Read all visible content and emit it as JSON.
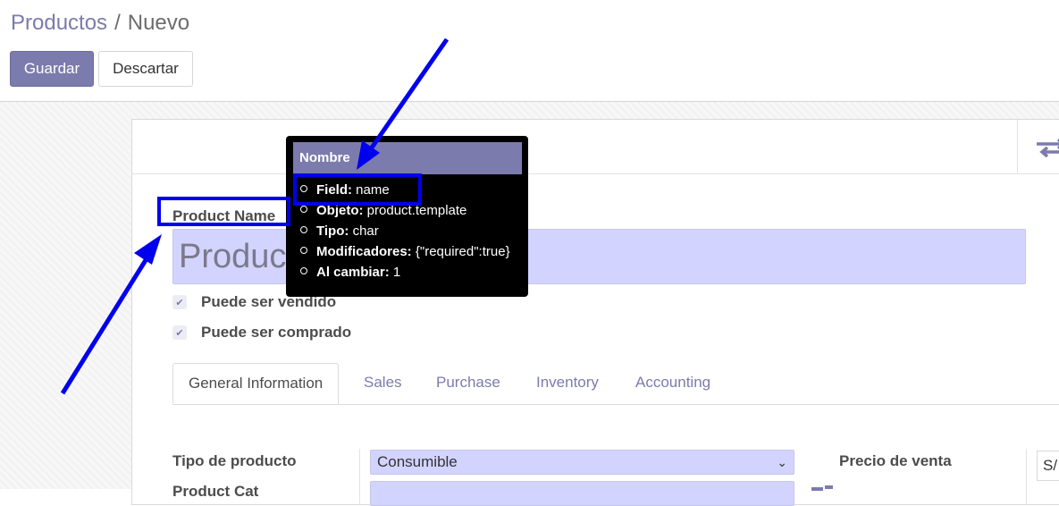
{
  "breadcrumb": {
    "parent": "Productos",
    "separator": "/",
    "current": "Nuevo"
  },
  "actions": {
    "save_label": "Guardar",
    "discard_label": "Descartar"
  },
  "form": {
    "name_label": "Product Name",
    "name_placeholder": "Product",
    "checkboxes": [
      {
        "label": "Puede ser vendido",
        "checked": true
      },
      {
        "label": "Puede ser comprado",
        "checked": true
      }
    ],
    "tabs": [
      "General Information",
      "Sales",
      "Purchase",
      "Inventory",
      "Accounting"
    ],
    "active_tab": "General Information",
    "fields": {
      "product_type_label": "Tipo de producto",
      "product_type_value": "Consumible",
      "category_label": "Product Cat",
      "sale_price_label": "Precio de venta",
      "currency_value": "S/"
    }
  },
  "tooltip": {
    "title": "Nombre",
    "items": [
      {
        "key": "Field:",
        "value": "name"
      },
      {
        "key": "Objeto:",
        "value": "product.template"
      },
      {
        "key": "Tipo:",
        "value": "char"
      },
      {
        "key": "Modificadores:",
        "value": "{\"required\":true}"
      },
      {
        "key": "Al cambiar:",
        "value": "1"
      }
    ]
  },
  "colors": {
    "brand": "#7c7bad",
    "required_field": "#d3d3ff",
    "annotation": "#0000ee"
  }
}
